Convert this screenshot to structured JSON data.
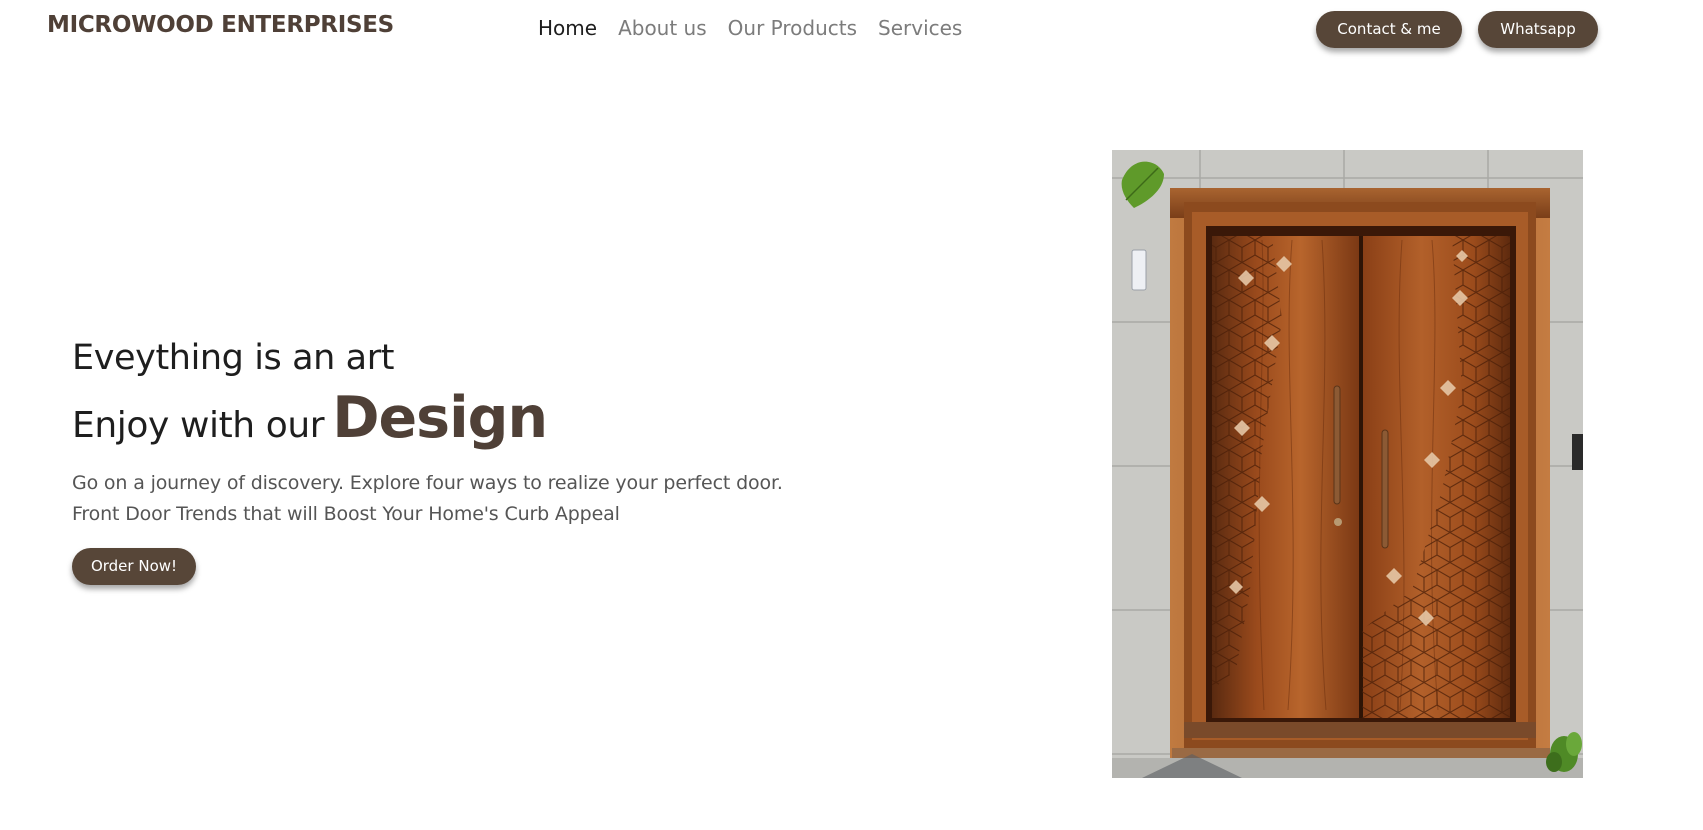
{
  "navbar": {
    "brand": "MICROWOOD ENTERPRISES",
    "links": [
      {
        "label": "Home",
        "active": true
      },
      {
        "label": "About us",
        "active": false
      },
      {
        "label": "Our Products",
        "active": false
      },
      {
        "label": "Services",
        "active": false
      }
    ],
    "contact_label": "Contact & me",
    "whatsapp_label": "Whatsapp"
  },
  "hero": {
    "line1": "Eveything is an art",
    "line2_prefix": "Enjoy with our",
    "line2_emphasis": "Design",
    "description_line1": "Go on a journey of discovery. Explore four ways to realize your perfect door.",
    "description_line2": "Front Door Trends that will Boost Your Home's Curb Appeal",
    "order_label": "Order Now!"
  },
  "image": {
    "subject": "wooden-double-door"
  },
  "colors": {
    "brand_brown": "#4f4037",
    "button_brown": "#574638",
    "nav_inactive": "#7c7c7c",
    "nav_active": "#1d1d1d"
  }
}
